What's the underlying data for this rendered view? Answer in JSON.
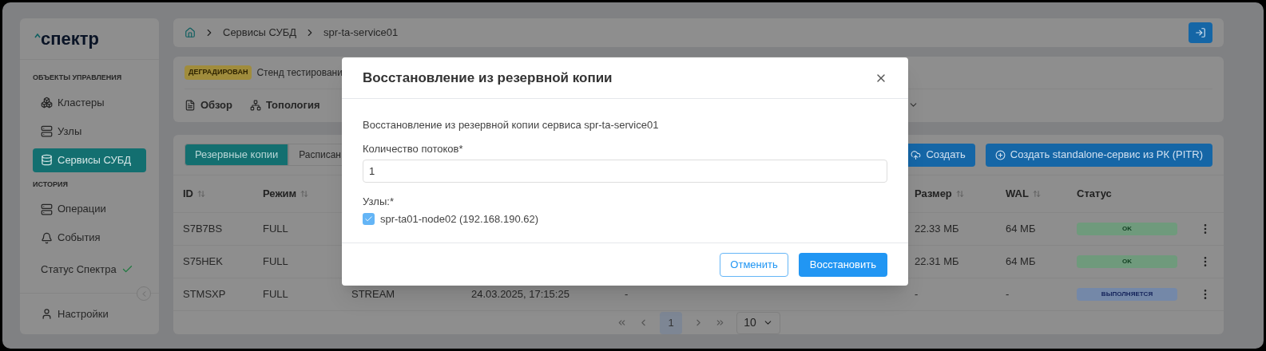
{
  "logo": "спектр",
  "sidebar": {
    "sections": [
      {
        "title": "ОБЪЕКТЫ УПРАВЛЕНИЯ",
        "items": [
          {
            "label": "Кластеры",
            "kind": "cluster",
            "selected": false
          },
          {
            "label": "Узлы",
            "kind": "server",
            "selected": false
          },
          {
            "label": "Сервисы СУБД",
            "kind": "database",
            "selected": true
          }
        ]
      },
      {
        "title": "ИСТОРИЯ",
        "items": [
          {
            "label": "Операции",
            "kind": "server",
            "selected": false
          },
          {
            "label": "События",
            "kind": "bell",
            "selected": false
          }
        ]
      }
    ],
    "status": {
      "label": "Статус Спектра",
      "ok": true
    },
    "settings": "Настройки"
  },
  "breadcrumb": [
    "Сервисы СУБД",
    "spr-ta-service01"
  ],
  "service": {
    "badge": "ДЕГРАДИРОВАН",
    "name": "Стенд тестировани",
    "tabs": [
      {
        "label": "Обзор",
        "kind": "doc"
      },
      {
        "label": "Топология",
        "kind": "topology"
      }
    ]
  },
  "subtabs": [
    {
      "label": "Резервные копии",
      "selected": true
    },
    {
      "label": "Расписан",
      "selected": false
    }
  ],
  "actions": [
    {
      "label": "Создать",
      "kind": "upload"
    },
    {
      "label": "Создать standalone-сервис из РК (PITR)",
      "kind": "plus"
    }
  ],
  "table": {
    "columns": [
      {
        "label": "ID",
        "sortable": true
      },
      {
        "label": "Режим",
        "sortable": true
      },
      {
        "label": "Размер",
        "sortable": true
      },
      {
        "label": "WAL",
        "sortable": true
      },
      {
        "label": "Статус",
        "sortable": false
      }
    ],
    "rows": [
      {
        "id": "S7B7BS",
        "mode": "FULL",
        "size": "22.33 МБ",
        "wal": "64 МБ",
        "status": {
          "label": "OK",
          "kind": "ok"
        }
      },
      {
        "id": "S75HEK",
        "mode": "FULL",
        "size": "22.31 МБ",
        "wal": "64 МБ",
        "status": {
          "label": "OK",
          "kind": "ok"
        }
      },
      {
        "id": "STMSXP",
        "mode": "FULL",
        "column_3": "STREAM",
        "column_4": "24.03.2025, 17:15:25",
        "column_5": "-",
        "size": "-",
        "wal": "-",
        "status": {
          "label": "ВЫПОЛНЯЕТСЯ",
          "kind": "running"
        }
      }
    ]
  },
  "pagination": {
    "pages": [
      {
        "label": "1",
        "selected": true
      }
    ],
    "page_size": "10"
  },
  "modal": {
    "title": "Восстановление из резервной копии",
    "text": "Восстановление из резервной копии сервиса spr-ta-service01",
    "field": {
      "label": "Количество потоков*",
      "value": "1"
    },
    "nodes_label": "Узлы:*",
    "nodes": [
      {
        "label": "spr-ta01-node02 (192.168.190.62)",
        "checked": true
      }
    ],
    "cancel": "Отменить",
    "confirm": "Восстановить"
  }
}
